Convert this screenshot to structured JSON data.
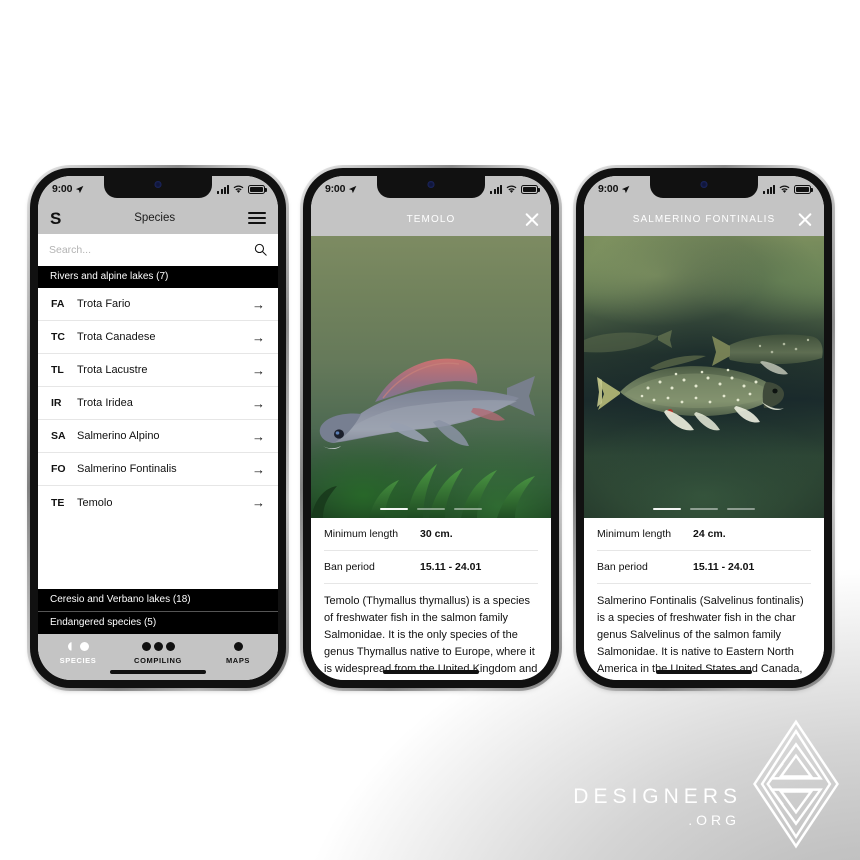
{
  "background": {
    "accent_gray": "#c4c4c4",
    "frame_black": "#111111"
  },
  "watermark": {
    "brand": "DESIGNERS",
    "tld": ".ORG"
  },
  "phones": [
    {
      "id": "species-list",
      "status_bar": {
        "time": "9:00"
      },
      "navbar": {
        "logo": "S",
        "title": "Species",
        "menu_icon": "hamburger-icon"
      },
      "search": {
        "value": "",
        "placeholder": "Search..."
      },
      "sections": [
        {
          "title": "Rivers and alpine lakes (7)",
          "items": [
            {
              "code": "FA",
              "name": "Trota Fario"
            },
            {
              "code": "TC",
              "name": "Trota Canadese"
            },
            {
              "code": "TL",
              "name": "Trota Lacustre"
            },
            {
              "code": "IR",
              "name": "Trota Iridea"
            },
            {
              "code": "SA",
              "name": "Salmerino Alpino"
            },
            {
              "code": "FO",
              "name": "Salmerino Fontinalis"
            },
            {
              "code": "TE",
              "name": "Temolo"
            }
          ]
        },
        {
          "title": "Ceresio and Verbano lakes (18)",
          "items": []
        },
        {
          "title": "Endangered species (5)",
          "items": []
        }
      ],
      "tabbar": [
        {
          "label": "SPECIES",
          "icon": "half-dot-and-dot-icon",
          "active": true
        },
        {
          "label": "COMPILING",
          "icon": "three-dots-icon",
          "active": false
        },
        {
          "label": "MAPS",
          "icon": "single-dot-icon",
          "active": false
        }
      ]
    },
    {
      "id": "temolo-detail",
      "status_bar": {
        "time": "9:00"
      },
      "navbar": {
        "title": "TEMOLO",
        "close_icon": "close-icon"
      },
      "gallery": {
        "pages": 3,
        "active_page": 1
      },
      "facts": [
        {
          "label": "Minimum length",
          "value": "30 cm."
        },
        {
          "label": "Ban period",
          "value": "15.11 - 24.01"
        }
      ],
      "description": "Temolo (Thymallus thymallus) is a species of freshwater fish in the salmon family Salmonidae. It is the only species of the genus Thymallus native to Europe, where it is widespread from the United Kingdom and France to the Ural Mountains in"
    },
    {
      "id": "salmerino-detail",
      "status_bar": {
        "time": "9:00"
      },
      "navbar": {
        "title": "SALMERINO FONTINALIS",
        "close_icon": "close-icon"
      },
      "gallery": {
        "pages": 3,
        "active_page": 1
      },
      "facts": [
        {
          "label": "Minimum length",
          "value": "24 cm."
        },
        {
          "label": "Ban period",
          "value": "15.11 - 24.01"
        }
      ],
      "description": "Salmerino Fontinalis (Salvelinus fontinalis) is a species of freshwater fish in the char genus Salvelinus of the salmon family Salmonidae. It is native to Eastern North America in the United States and Canada, but has been introduced elsewhere in"
    }
  ]
}
